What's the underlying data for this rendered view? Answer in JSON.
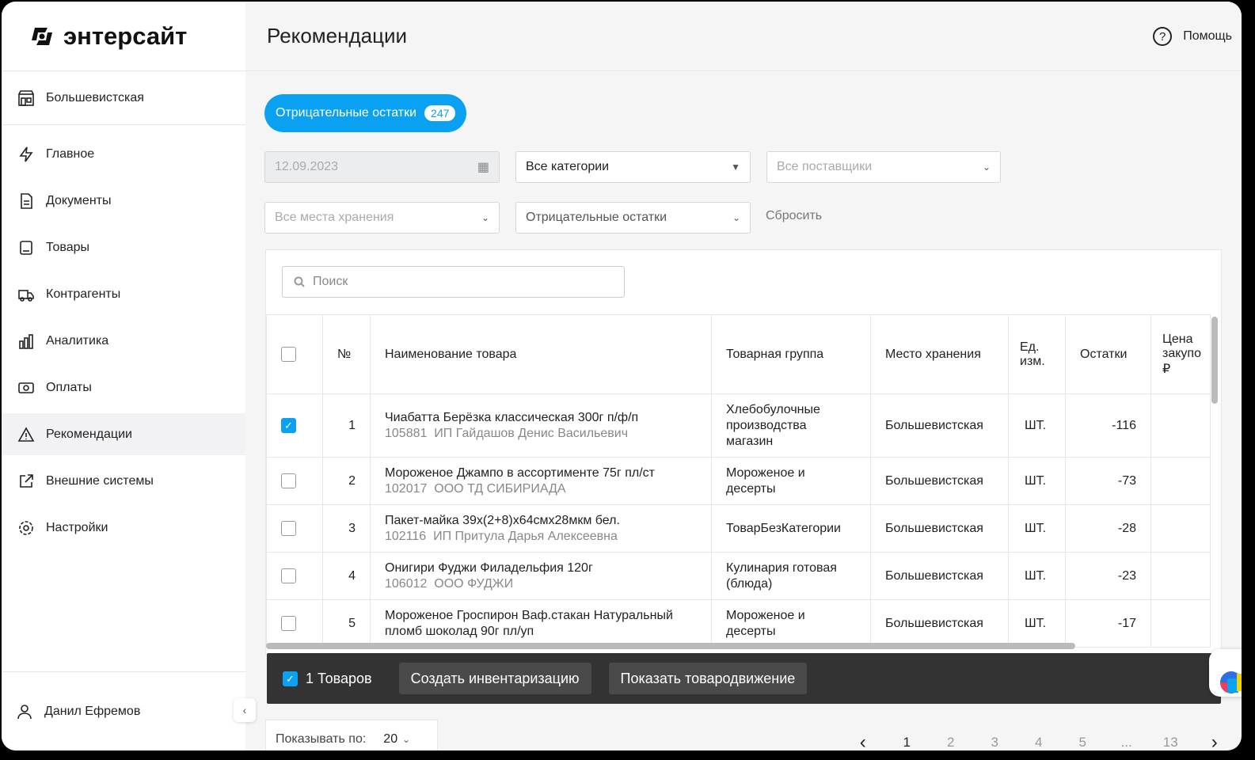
{
  "app": {
    "logo": "энтерсайт",
    "store": "Большевистская",
    "user": "Данил Ефремов"
  },
  "nav": [
    {
      "label": "Главное",
      "icon": "lightning-icon"
    },
    {
      "label": "Документы",
      "icon": "document-icon"
    },
    {
      "label": "Товары",
      "icon": "product-icon"
    },
    {
      "label": "Контрагенты",
      "icon": "truck-icon"
    },
    {
      "label": "Аналитика",
      "icon": "chart-icon"
    },
    {
      "label": "Оплаты",
      "icon": "money-icon"
    },
    {
      "label": "Рекомендации",
      "icon": "warning-icon",
      "active": true
    },
    {
      "label": "Внешние системы",
      "icon": "external-link-icon"
    },
    {
      "label": "Настройки",
      "icon": "gear-icon"
    }
  ],
  "header": {
    "title": "Рекомендации",
    "help": "Помощь"
  },
  "chip": {
    "label": "Отрицательные остатки",
    "count": "247"
  },
  "filters": {
    "date": "12.09.2023",
    "category": "Все категории",
    "suppliers": "Все поставщики",
    "storage": "Все места хранения",
    "type": "Отрицательные остатки",
    "reset": "Сбросить"
  },
  "search": {
    "placeholder": "Поиск"
  },
  "columns": [
    "№",
    "Наименование товара",
    "Товарная группа",
    "Место хранения",
    "Ед. изм.",
    "Остатки",
    "Цена закупо ₽"
  ],
  "rows": [
    {
      "n": "1",
      "name": "Чиабатта Берёзка классическая 300г п/ф/п",
      "code": "105881",
      "supplier": "ИП Гайдашов Денис Васильевич",
      "group": "Хлебобулочные производства магазин",
      "place": "Большевистская",
      "unit": "ШТ.",
      "stock": "-116",
      "checked": true
    },
    {
      "n": "2",
      "name": "Мороженое Джампо в ассортименте 75г пл/ст",
      "code": "102017",
      "supplier": "ООО ТД СИБИРИАДА",
      "group": "Мороженое и десерты",
      "place": "Большевистская",
      "unit": "ШТ.",
      "stock": "-73"
    },
    {
      "n": "3",
      "name": "Пакет-майка 39х(2+8)х64смх28мкм бел.",
      "code": "102116",
      "supplier": "ИП Притула Дарья Алексеевна",
      "group": "ТоварБезКатегории",
      "place": "Большевистская",
      "unit": "ШТ.",
      "stock": "-28"
    },
    {
      "n": "4",
      "name": "Онигири Фуджи Филадельфия 120г",
      "code": "106012",
      "supplier": "ООО ФУДЖИ",
      "group": "Кулинария готовая (блюда)",
      "place": "Большевистская",
      "unit": "ШТ.",
      "stock": "-23"
    },
    {
      "n": "5",
      "name": "Мороженое Гроспирон Ваф.стакан Натуральный пломб шоколад 90г пл/уп",
      "code": "",
      "supplier": "",
      "group": "Мороженое и десерты",
      "place": "Большевистская",
      "unit": "ШТ.",
      "stock": "-17"
    }
  ],
  "actions": {
    "selected": "1 Товаров",
    "create": "Создать инвентаризацию",
    "show": "Показать товародвижение"
  },
  "pagination": {
    "per_page_label": "Показывать по:",
    "per_page": "20",
    "pages": [
      "1",
      "2",
      "3",
      "4",
      "5",
      "...",
      "13"
    ],
    "current": "1"
  }
}
